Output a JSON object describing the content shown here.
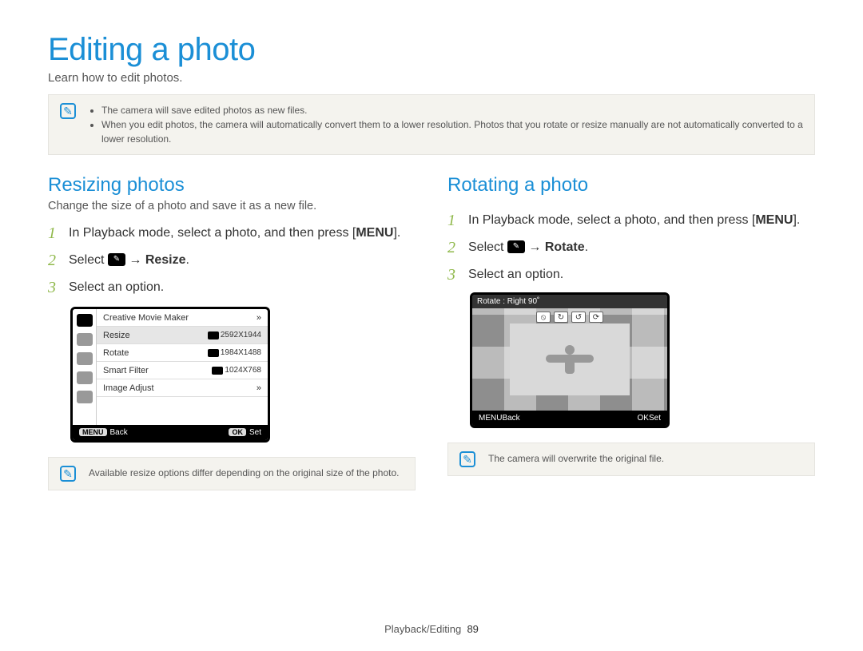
{
  "title": "Editing a photo",
  "subtitle": "Learn how to edit photos.",
  "top_notes": [
    "The camera will save edited photos as new files.",
    "When you edit photos, the camera will automatically convert them to a lower resolution. Photos that you rotate or resize manually are not automatically converted to a lower resolution."
  ],
  "left": {
    "heading": "Resizing photos",
    "sub": "Change the size of a photo and save it as a new file.",
    "steps": {
      "s1a": "In Playback mode, select a photo, and then press ",
      "s1b": "[",
      "s1c": "MENU",
      "s1d": "].",
      "s2a": "Select ",
      "s2b": " → ",
      "s2c": "Resize",
      "s2d": ".",
      "s3": "Select an option."
    },
    "menu": {
      "items": [
        "Creative Movie Maker",
        "Resize",
        "Rotate",
        "Smart Filter",
        "Image Adjust"
      ],
      "sizes": [
        "2592X1944",
        "1984X1488",
        "1024X768"
      ],
      "back": "Back",
      "set": "Set",
      "menu_chip": "MENU",
      "ok_chip": "OK"
    },
    "note": "Available resize options differ depending on the original size of the photo."
  },
  "right": {
    "heading": "Rotating a photo",
    "steps": {
      "s1a": "In Playback mode, select a photo, and then press ",
      "s1b": "[",
      "s1c": "MENU",
      "s1d": "].",
      "s2a": "Select ",
      "s2b": " → ",
      "s2c": "Rotate",
      "s2d": ".",
      "s3": "Select an option."
    },
    "screen": {
      "header": "Rotate : Right 90˚",
      "back": "Back",
      "set": "Set",
      "menu_chip": "MENU",
      "ok_chip": "OK"
    },
    "note": "The camera will overwrite the original file."
  },
  "footer": {
    "section": "Playback/Editing",
    "page": "89"
  }
}
